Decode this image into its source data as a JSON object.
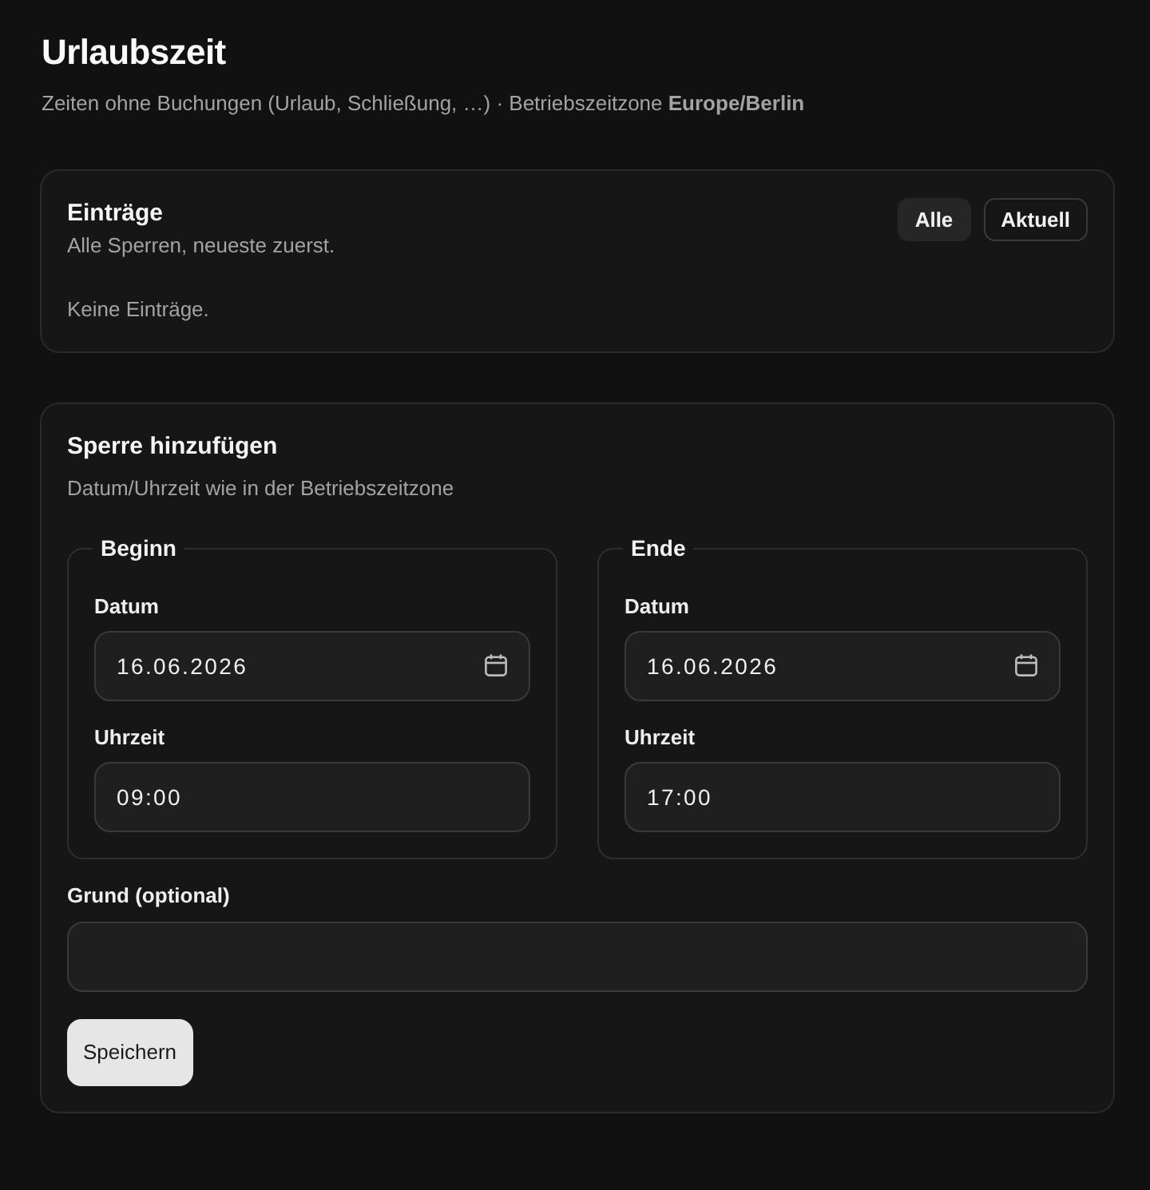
{
  "page": {
    "title": "Urlaubszeit",
    "subtitle": "Zeiten ohne Buchungen (Urlaub, Schließung, …) · Betriebszeitzone **Europe/Berlin**"
  },
  "entries": {
    "title": "Einträge",
    "description": "Alle Sperren, neueste zuerst.",
    "filters": [
      {
        "label": "Alle",
        "selected": true
      },
      {
        "label": "Aktuell",
        "selected": false
      }
    ],
    "empty_message": "Keine Einträge."
  },
  "form": {
    "title": "Sperre hinzufügen",
    "description": "Datum/Uhrzeit wie in der Betriebszeitzone",
    "groups": [
      {
        "legend": "Beginn",
        "fields": [
          {
            "kind": "date",
            "label": "Datum",
            "value": "16.06.2026"
          },
          {
            "kind": "time",
            "label": "Uhrzeit",
            "value": "09:00"
          }
        ]
      },
      {
        "legend": "Ende",
        "fields": [
          {
            "kind": "date",
            "label": "Datum",
            "value": "16.06.2026"
          },
          {
            "kind": "time",
            "label": "Uhrzeit",
            "value": "17:00"
          }
        ]
      }
    ],
    "reason": {
      "label": "Grund (optional)"
    },
    "submit": "Speichern"
  }
}
